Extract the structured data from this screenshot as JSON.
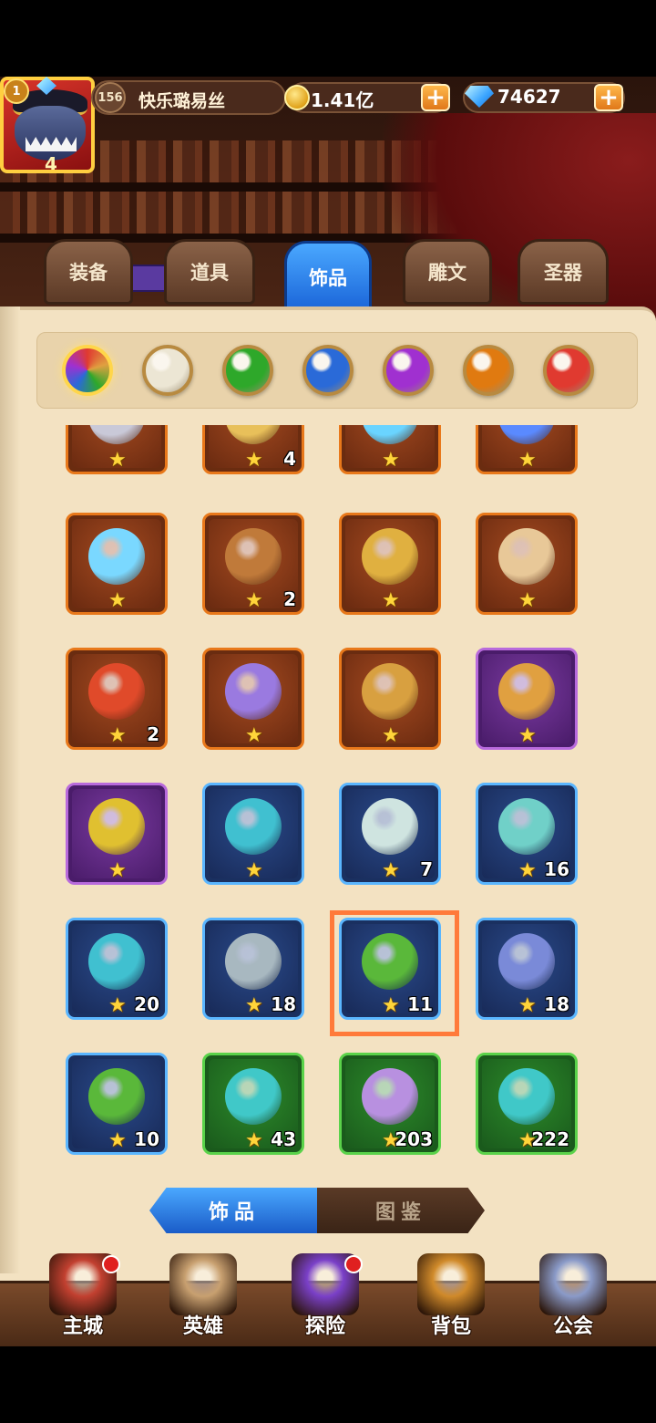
{
  "header": {
    "level": "156",
    "player_name": "快乐璐易丝",
    "coins": "1.41亿",
    "gems": "74627",
    "plus": "+"
  },
  "avatar": {
    "vip": "1",
    "stars": "4"
  },
  "tabs": [
    {
      "label": "装备",
      "active": false
    },
    {
      "label": "道具",
      "active": false
    },
    {
      "label": "饰品",
      "active": true
    },
    {
      "label": "雕文",
      "active": false
    },
    {
      "label": "圣器",
      "active": false
    }
  ],
  "filters": [
    {
      "name": "all",
      "color": "#e0a040",
      "selected": true
    },
    {
      "name": "white",
      "color": "#ece6d4"
    },
    {
      "name": "green",
      "color": "#2ea82a"
    },
    {
      "name": "blue",
      "color": "#2a6ad8"
    },
    {
      "name": "purple",
      "color": "#a030d0"
    },
    {
      "name": "orange",
      "color": "#e07a10"
    },
    {
      "name": "red",
      "color": "#e03a30"
    }
  ],
  "items": [
    {
      "rarity": "brown",
      "count": "",
      "art": "#c9c9d8"
    },
    {
      "rarity": "brown",
      "count": "4",
      "art": "#e8c05a"
    },
    {
      "rarity": "brown",
      "count": "",
      "art": "#6ad4ff"
    },
    {
      "rarity": "brown",
      "count": "",
      "art": "#5a8aff"
    },
    {
      "rarity": "brown",
      "count": "",
      "art": "#7ad8ff"
    },
    {
      "rarity": "brown",
      "count": "2",
      "art": "#c07a3a"
    },
    {
      "rarity": "brown",
      "count": "",
      "art": "#e0b040"
    },
    {
      "rarity": "brown",
      "count": "",
      "art": "#e8c898"
    },
    {
      "rarity": "brown",
      "count": "2",
      "art": "#e04a2a"
    },
    {
      "rarity": "brown",
      "count": "",
      "art": "#9a7ae0"
    },
    {
      "rarity": "brown",
      "count": "",
      "art": "#d8a040"
    },
    {
      "rarity": "purple",
      "count": "",
      "art": "#e0a040"
    },
    {
      "rarity": "purple",
      "count": "",
      "art": "#e0c030"
    },
    {
      "rarity": "blue",
      "count": "",
      "art": "#40c0d0"
    },
    {
      "rarity": "blue",
      "count": "7",
      "art": "#cfe4e0"
    },
    {
      "rarity": "blue",
      "count": "16",
      "art": "#70d0c8"
    },
    {
      "rarity": "blue",
      "count": "20",
      "art": "#40c0d0"
    },
    {
      "rarity": "blue",
      "count": "18",
      "art": "#a8b8c0"
    },
    {
      "rarity": "blue",
      "count": "11",
      "art": "#5ab83a",
      "highlighted": true
    },
    {
      "rarity": "blue",
      "count": "18",
      "art": "#7a8ad8"
    },
    {
      "rarity": "blue",
      "count": "10",
      "art": "#5ab83a"
    },
    {
      "rarity": "green",
      "count": "43",
      "art": "#40c8c8"
    },
    {
      "rarity": "green",
      "count": "203",
      "art": "#b890e0"
    },
    {
      "rarity": "green",
      "count": "222",
      "art": "#40c8c8"
    }
  ],
  "bottom_toggle": {
    "left": "饰品",
    "right": "图鉴"
  },
  "nav": [
    {
      "label": "主城",
      "color": "#c24030",
      "dot": true
    },
    {
      "label": "英雄",
      "color": "#c8a070",
      "dot": false
    },
    {
      "label": "探险",
      "color": "#7a40c8",
      "dot": true
    },
    {
      "label": "背包",
      "color": "#d08a2a",
      "dot": false
    },
    {
      "label": "公会",
      "color": "#8a9ac8",
      "dot": false
    }
  ]
}
